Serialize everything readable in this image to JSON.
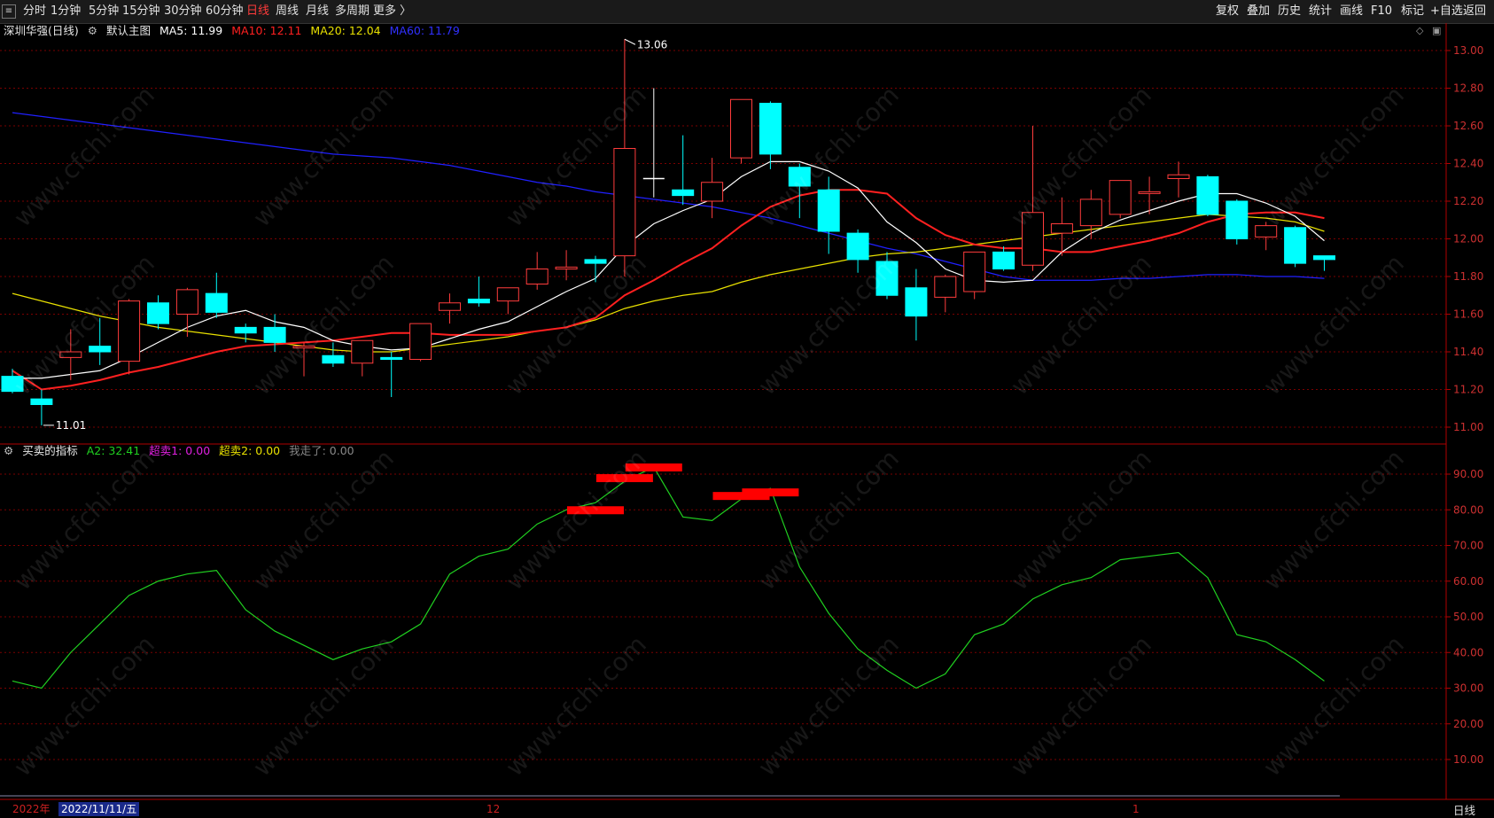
{
  "toolbar": {
    "menu_icon": "menu-icon",
    "periods": [
      "分时",
      "1分钟",
      "5分钟",
      "15分钟",
      "30分钟",
      "60分钟",
      "日线",
      "周线",
      "月线",
      "多周期",
      "更多 〉"
    ],
    "active_period": "日线",
    "right_buttons": [
      "复权",
      "叠加",
      "历史",
      "统计",
      "画线",
      "F10",
      "标记",
      "+自选",
      "返回"
    ]
  },
  "main_legend": {
    "title": "深圳华强(日线)",
    "template_icon": "gear-icon",
    "template": "默认主图",
    "ma5": "MA5: 11.99",
    "ma10": "MA10: 12.11",
    "ma20": "MA20: 12.04",
    "ma60": "MA60: 11.79"
  },
  "indicator_legend": {
    "icon": "gear-icon",
    "name": "买卖的指标",
    "a2": "A2: 32.41",
    "oversell1": "超卖1: 0.00",
    "oversell2": "超卖2: 0.00",
    "gone": "我走了: 0.00"
  },
  "bottom": {
    "year": "2022年",
    "current_date": "2022/11/11/五",
    "month_12": "12",
    "month_1": "1",
    "period_label": "日线"
  },
  "colors": {
    "up": "#ff3c3c",
    "down": "#00ffff",
    "ma5": "#ffffff",
    "ma10": "#ff2020",
    "ma20": "#e8e000",
    "ma60": "#2020ff",
    "a2": "#20d020",
    "signal": "#ff0000",
    "grid": "#7a0000"
  },
  "watermark": "www.cfchi.com",
  "chart_data": [
    {
      "type": "candlestick",
      "title": "深圳华强(日线)",
      "ylim": [
        11.0,
        13.1
      ],
      "y_ticks": [
        "13.00",
        "12.80",
        "12.60",
        "12.40",
        "12.20",
        "12.00",
        "11.80",
        "11.60",
        "11.40",
        "11.20",
        "11.00"
      ],
      "high_label": "13.06",
      "low_label": "11.01",
      "candles": [
        {
          "o": 11.27,
          "h": 11.31,
          "l": 11.18,
          "c": 11.19
        },
        {
          "o": 11.15,
          "h": 11.2,
          "l": 11.01,
          "c": 11.12
        },
        {
          "o": 11.37,
          "h": 11.52,
          "l": 11.25,
          "c": 11.4
        },
        {
          "o": 11.43,
          "h": 11.58,
          "l": 11.33,
          "c": 11.4
        },
        {
          "o": 11.35,
          "h": 11.68,
          "l": 11.28,
          "c": 11.67
        },
        {
          "o": 11.66,
          "h": 11.7,
          "l": 11.52,
          "c": 11.55
        },
        {
          "o": 11.6,
          "h": 11.74,
          "l": 11.48,
          "c": 11.73
        },
        {
          "o": 11.71,
          "h": 11.82,
          "l": 11.58,
          "c": 11.61
        },
        {
          "o": 11.53,
          "h": 11.55,
          "l": 11.45,
          "c": 11.5
        },
        {
          "o": 11.53,
          "h": 11.6,
          "l": 11.4,
          "c": 11.45
        },
        {
          "o": 11.43,
          "h": 11.45,
          "l": 11.27,
          "c": 11.43
        },
        {
          "o": 11.38,
          "h": 11.45,
          "l": 11.32,
          "c": 11.34
        },
        {
          "o": 11.34,
          "h": 11.46,
          "l": 11.27,
          "c": 11.46
        },
        {
          "o": 11.37,
          "h": 11.4,
          "l": 11.16,
          "c": 11.36
        },
        {
          "o": 11.36,
          "h": 11.55,
          "l": 11.35,
          "c": 11.55
        },
        {
          "o": 11.62,
          "h": 11.71,
          "l": 11.55,
          "c": 11.66
        },
        {
          "o": 11.68,
          "h": 11.8,
          "l": 11.64,
          "c": 11.66
        },
        {
          "o": 11.67,
          "h": 11.72,
          "l": 11.6,
          "c": 11.74
        },
        {
          "o": 11.76,
          "h": 11.93,
          "l": 11.73,
          "c": 11.84
        },
        {
          "o": 11.84,
          "h": 11.94,
          "l": 11.78,
          "c": 11.85
        },
        {
          "o": 11.89,
          "h": 11.91,
          "l": 11.77,
          "c": 11.87
        },
        {
          "o": 11.91,
          "h": 13.06,
          "l": 11.8,
          "c": 12.48
        },
        {
          "o": 12.32,
          "h": 12.8,
          "l": 12.22,
          "c": 12.32
        },
        {
          "o": 12.26,
          "h": 12.55,
          "l": 12.18,
          "c": 12.23
        },
        {
          "o": 12.2,
          "h": 12.43,
          "l": 12.11,
          "c": 12.3
        },
        {
          "o": 12.43,
          "h": 12.74,
          "l": 12.4,
          "c": 12.74
        },
        {
          "o": 12.72,
          "h": 12.73,
          "l": 12.37,
          "c": 12.45
        },
        {
          "o": 12.38,
          "h": 12.4,
          "l": 12.11,
          "c": 12.28
        },
        {
          "o": 12.26,
          "h": 12.33,
          "l": 11.92,
          "c": 12.04
        },
        {
          "o": 12.03,
          "h": 12.05,
          "l": 11.82,
          "c": 11.89
        },
        {
          "o": 11.88,
          "h": 11.93,
          "l": 11.68,
          "c": 11.7
        },
        {
          "o": 11.74,
          "h": 11.84,
          "l": 11.46,
          "c": 11.59
        },
        {
          "o": 11.69,
          "h": 11.81,
          "l": 11.61,
          "c": 11.8
        },
        {
          "o": 11.72,
          "h": 11.91,
          "l": 11.68,
          "c": 11.93
        },
        {
          "o": 11.93,
          "h": 11.96,
          "l": 11.83,
          "c": 11.84
        },
        {
          "o": 11.86,
          "h": 12.6,
          "l": 11.83,
          "c": 12.14
        },
        {
          "o": 12.03,
          "h": 12.22,
          "l": 11.91,
          "c": 12.08
        },
        {
          "o": 12.07,
          "h": 12.26,
          "l": 12.0,
          "c": 12.21
        },
        {
          "o": 12.13,
          "h": 12.31,
          "l": 12.11,
          "c": 12.31
        },
        {
          "o": 12.25,
          "h": 12.33,
          "l": 12.13,
          "c": 12.25
        },
        {
          "o": 12.32,
          "h": 12.41,
          "l": 12.22,
          "c": 12.34
        },
        {
          "o": 12.33,
          "h": 12.34,
          "l": 12.12,
          "c": 12.13
        },
        {
          "o": 12.2,
          "h": 12.21,
          "l": 11.97,
          "c": 12.0
        },
        {
          "o": 12.01,
          "h": 12.09,
          "l": 11.94,
          "c": 12.07
        },
        {
          "o": 12.06,
          "h": 12.07,
          "l": 11.85,
          "c": 11.87
        },
        {
          "o": 11.91,
          "h": 11.91,
          "l": 11.83,
          "c": 11.89
        }
      ],
      "ma5": [
        11.26,
        11.26,
        11.28,
        11.3,
        11.37,
        11.45,
        11.53,
        11.59,
        11.62,
        11.56,
        11.53,
        11.46,
        11.43,
        11.41,
        11.42,
        11.47,
        11.52,
        11.56,
        11.64,
        11.72,
        11.79,
        11.96,
        12.08,
        12.15,
        12.21,
        12.33,
        12.41,
        12.41,
        12.36,
        12.27,
        12.09,
        11.98,
        11.84,
        11.78,
        11.77,
        11.78,
        11.93,
        12.03,
        12.1,
        12.15,
        12.2,
        12.24,
        12.24,
        12.19,
        12.12,
        11.99
      ],
      "ma10": [
        11.3,
        11.2,
        11.22,
        11.25,
        11.29,
        11.32,
        11.36,
        11.4,
        11.43,
        11.44,
        11.45,
        11.46,
        11.48,
        11.5,
        11.5,
        11.49,
        11.49,
        11.49,
        11.51,
        11.53,
        11.58,
        11.7,
        11.78,
        11.87,
        11.95,
        12.07,
        12.17,
        12.23,
        12.26,
        12.26,
        12.24,
        12.11,
        12.02,
        11.97,
        11.95,
        11.95,
        11.93,
        11.93,
        11.96,
        11.99,
        12.03,
        12.09,
        12.13,
        12.14,
        12.14,
        12.11
      ],
      "ma20": [
        11.71,
        11.67,
        11.63,
        11.59,
        11.56,
        11.53,
        11.51,
        11.49,
        11.47,
        11.45,
        11.43,
        11.41,
        11.4,
        11.4,
        11.42,
        11.44,
        11.46,
        11.48,
        11.51,
        11.53,
        11.57,
        11.63,
        11.67,
        11.7,
        11.72,
        11.77,
        11.81,
        11.84,
        11.87,
        11.9,
        11.92,
        11.93,
        11.95,
        11.97,
        11.99,
        12.01,
        12.03,
        12.05,
        12.07,
        12.09,
        12.11,
        12.13,
        12.12,
        12.11,
        12.09,
        12.04
      ],
      "ma60": [
        12.67,
        12.65,
        12.63,
        12.61,
        12.59,
        12.57,
        12.55,
        12.53,
        12.51,
        12.49,
        12.47,
        12.45,
        12.44,
        12.43,
        12.41,
        12.39,
        12.36,
        12.33,
        12.3,
        12.28,
        12.25,
        12.23,
        12.21,
        12.19,
        12.17,
        12.14,
        12.11,
        12.07,
        12.03,
        11.99,
        11.95,
        11.92,
        11.88,
        11.84,
        11.8,
        11.78,
        11.78,
        11.78,
        11.79,
        11.79,
        11.8,
        11.81,
        11.81,
        11.8,
        11.8,
        11.79
      ]
    },
    {
      "type": "line",
      "title": "买卖的指标",
      "ylim": [
        0,
        95
      ],
      "y_ticks": [
        "90.00",
        "80.00",
        "70.00",
        "60.00",
        "50.00",
        "40.00",
        "30.00",
        "20.00",
        "10.00"
      ],
      "series": [
        {
          "name": "A2",
          "values": [
            32,
            30,
            40,
            48,
            56,
            60,
            62,
            63,
            52,
            46,
            42,
            38,
            41,
            43,
            48,
            62,
            67,
            69,
            76,
            80,
            82,
            88,
            92,
            78,
            77,
            83,
            86,
            64,
            51,
            41,
            35,
            30,
            34,
            45,
            48,
            55,
            59,
            61,
            66,
            67,
            68,
            61,
            45,
            43,
            38,
            32
          ]
        }
      ],
      "signals": [
        {
          "index": 20,
          "value": 80
        },
        {
          "index": 21,
          "value": 89
        },
        {
          "index": 22,
          "value": 92
        },
        {
          "index": 25,
          "value": 84
        },
        {
          "index": 26,
          "value": 85
        }
      ]
    }
  ]
}
